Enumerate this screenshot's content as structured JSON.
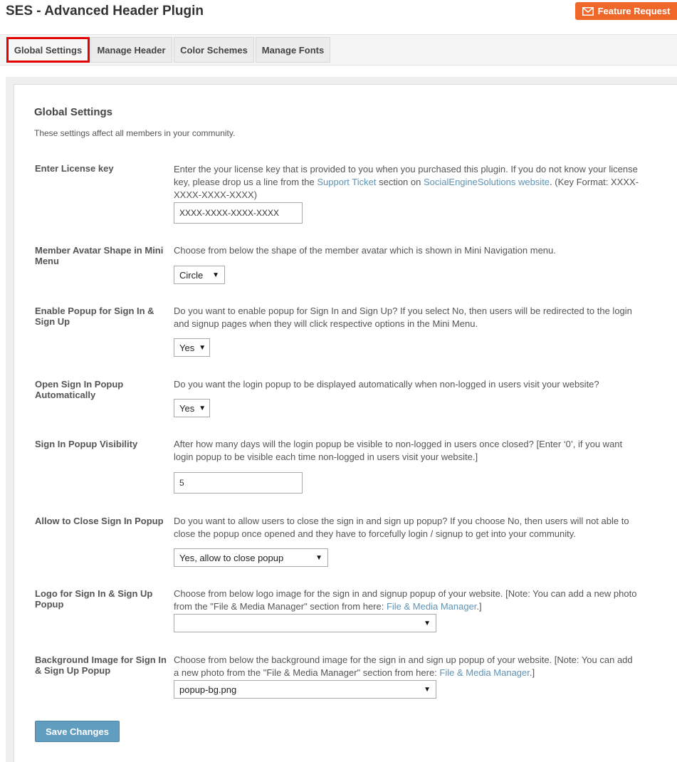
{
  "page": {
    "title": "SES - Advanced Header Plugin"
  },
  "feature_request": {
    "label": "Feature Request",
    "icon": "envelope-icon"
  },
  "tabs": [
    {
      "label": "Global Settings",
      "active": true
    },
    {
      "label": "Manage Header",
      "active": false
    },
    {
      "label": "Color Schemes",
      "active": false
    },
    {
      "label": "Manage Fonts",
      "active": false
    }
  ],
  "form": {
    "heading": "Global Settings",
    "description": "These settings affect all members in your community.",
    "license": {
      "label": "Enter License key",
      "help_1": "Enter the your license key that is provided to you when you purchased this plugin. If you do not know your license key, please drop us a line from the ",
      "link_1": "Support Ticket",
      "help_2": " section on ",
      "link_2": "SocialEngineSolutions website",
      "help_3": ". (Key Format: XXXX-XXXX-XXXX-XXXX)",
      "value": "XXXX-XXXX-XXXX-XXXX"
    },
    "avatar_shape": {
      "label": "Member Avatar Shape in Mini Menu",
      "help": "Choose from below the shape of the member avatar which is shown in Mini Navigation menu.",
      "value": "Circle"
    },
    "enable_popup": {
      "label": "Enable Popup for Sign In & Sign Up",
      "help": "Do you want to enable popup for Sign In and Sign Up? If you select No, then users will be redirected to the login and signup pages when they will click respective options in the Mini Menu.",
      "value": "Yes"
    },
    "auto_open": {
      "label": "Open Sign In Popup Automatically",
      "help": "Do you want the login popup to be displayed automatically when non-logged in users visit your website?",
      "value": "Yes"
    },
    "visibility": {
      "label": "Sign In Popup Visibility",
      "help": "After how many days will the login popup be visible to non-logged in users once closed? [Enter ‘0’, if you want login popup to be visible each time non-logged in users visit your website.]",
      "value": "5"
    },
    "allow_close": {
      "label": "Allow to Close Sign In Popup",
      "help": "Do you want to allow users to close the sign in and sign up popup? If you choose No, then users will not able to close the popup once opened and they have to forcefully login / signup to get into your community.",
      "value": "Yes, allow to close popup"
    },
    "logo": {
      "label": "Logo for Sign In & Sign Up Popup",
      "help_1": "Choose from below logo image for the sign in and signup popup of your website. [Note: You can add a new photo from the \"File & Media Manager\" section from here: ",
      "link": "File & Media Manager",
      "help_2": ".]",
      "value": ""
    },
    "background": {
      "label": "Background Image for Sign In & Sign Up Popup",
      "help_1": "Choose from below the background image for the sign in and sign up popup of your website. [Note: You can add a new photo from the \"File & Media Manager\" section from here: ",
      "link": "File & Media Manager",
      "help_2": ".]",
      "value": "popup-bg.png"
    },
    "save_label": "Save Changes"
  }
}
